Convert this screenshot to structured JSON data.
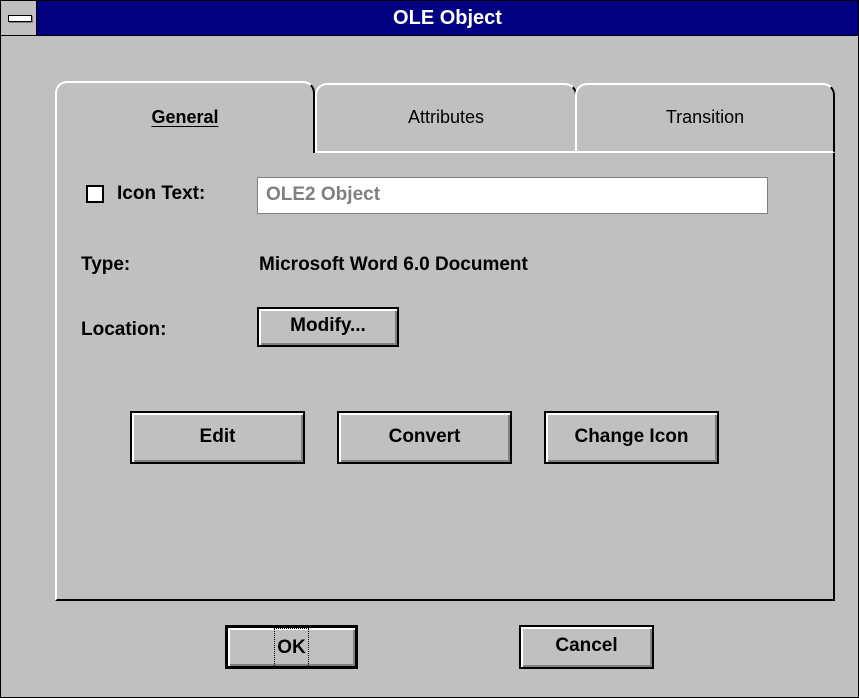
{
  "window": {
    "title": "OLE Object"
  },
  "tabs": [
    {
      "label": "General",
      "accel": "G"
    },
    {
      "label": "Attributes",
      "accel": "A"
    },
    {
      "label": "Transition",
      "accel": "T"
    }
  ],
  "general": {
    "icon_text_label": "Icon Text:",
    "icon_text_checked": false,
    "icon_text_value": "OLE2 Object",
    "type_label": "Type:",
    "type_value": "Microsoft Word 6.0 Document",
    "location_label": "Location:",
    "modify_button": "Modify...",
    "edit_button": "Edit",
    "convert_button": "Convert",
    "change_icon_button": "Change Icon"
  },
  "footer": {
    "ok_button": "OK",
    "cancel_button": "Cancel"
  }
}
